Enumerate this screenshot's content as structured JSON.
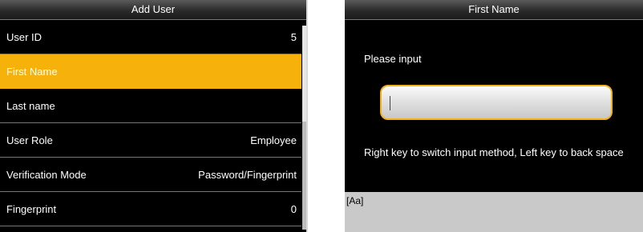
{
  "left_screen": {
    "title": "Add User",
    "items": [
      {
        "label": "User ID",
        "value": "5"
      },
      {
        "label": "First Name",
        "value": ""
      },
      {
        "label": "Last name",
        "value": ""
      },
      {
        "label": "User Role",
        "value": "Employee"
      },
      {
        "label": "Verification Mode",
        "value": "Password/Fingerprint"
      },
      {
        "label": "Fingerprint",
        "value": "0"
      }
    ],
    "selected_index": 1
  },
  "right_screen": {
    "title": "First Name",
    "prompt": "Please input",
    "input_value": "",
    "hint": "Right key to switch input method, Left key to back space",
    "input_method": "[Aa]"
  },
  "colors": {
    "highlight": "#f6b10b",
    "input_border": "#f3b21a",
    "screen_bg": "#000000",
    "footer_bg": "#c9c9c9"
  }
}
